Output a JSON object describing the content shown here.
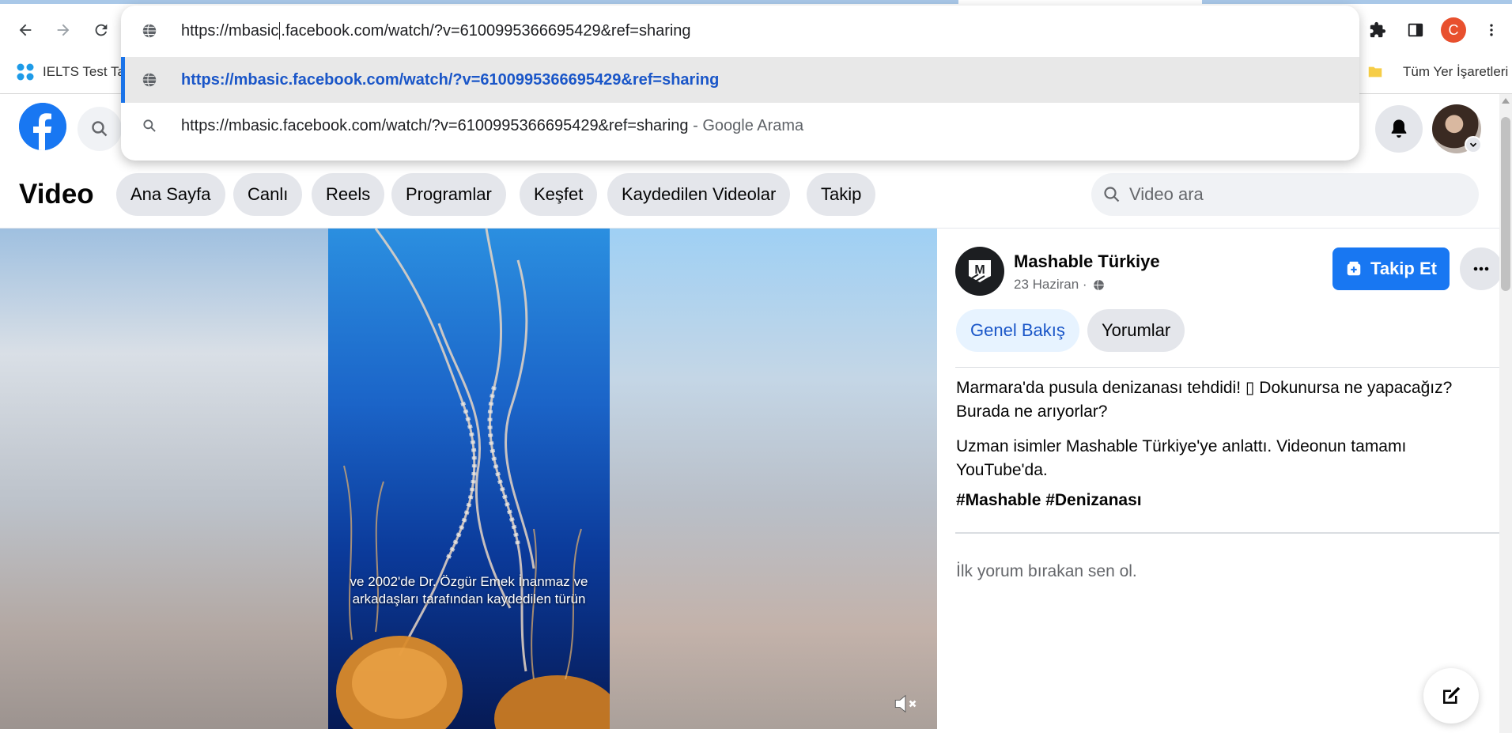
{
  "browser": {
    "address_url": "https://mbasic.facebook.com/watch/?v=6100995366695429&ref=sharing",
    "address_url_before_caret": "https://mbasic",
    "address_url_after_caret": ".facebook.com/watch/?v=6100995366695429&ref=sharing",
    "suggestion_1": "https://mbasic.facebook.com/watch/?v=6100995366695429&ref=sharing",
    "suggestion_2": "https://mbasic.facebook.com/watch/?v=6100995366695429&ref=sharing",
    "suggestion_2_sub": " - Google Arama",
    "profile_letter": "C",
    "bookmarks": [
      {
        "label": "IELTS Test Ta"
      }
    ],
    "all_bookmarks_label": "Tüm Yer İşaretleri"
  },
  "video_nav": {
    "title": "Video",
    "tabs": [
      {
        "label": "Ana Sayfa"
      },
      {
        "label": "Canlı"
      },
      {
        "label": "Reels"
      },
      {
        "label": "Programlar"
      },
      {
        "label": "Keşfet"
      },
      {
        "label": "Kaydedilen Videolar"
      },
      {
        "label": "Takip"
      }
    ],
    "search_placeholder": "Video ara"
  },
  "player": {
    "caption_line1": "ve 2002'de Dr. Özgür Emek İnanmaz ve",
    "caption_line2": "arkadaşları tarafından kaydedilen türün"
  },
  "post": {
    "page_name": "Mashable Türkiye",
    "date": "23 Haziran ·",
    "follow_label": "Takip Et",
    "tab_overview": "Genel Bakış",
    "tab_comments": "Yorumlar",
    "text_1": "Marmara'da pusula denizanası tehdidi! ▯ Dokunursa ne yapacağız? Burada ne arıyorlar?",
    "text_2": "Uzman isimler Mashable Türkiye'ye anlattı. Videonun tamamı YouTube'da.",
    "hashtags": "#Mashable #Denizanası",
    "no_comments": "İlk yorum bırakan sen ol."
  },
  "colors": {
    "facebook_blue": "#1877f2",
    "link_blue": "#1a56c8",
    "chip_gray": "#e4e6eb"
  }
}
